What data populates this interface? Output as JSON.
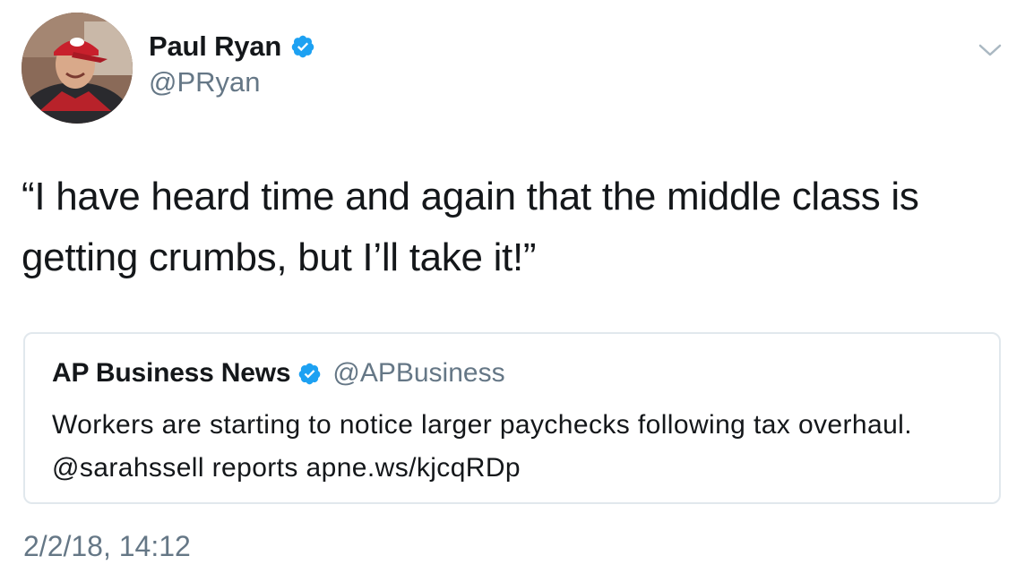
{
  "author": {
    "display_name": "Paul Ryan",
    "handle": "@PRyan",
    "verified": true,
    "avatar_icon": "profile-photo"
  },
  "tweet": {
    "text": "“I have heard time and again that the middle class is\ngetting crumbs, but I’ll take it!”",
    "timestamp": "2/2/18, 14:12"
  },
  "quoted_tweet": {
    "display_name": "AP Business News",
    "handle": "@APBusiness",
    "verified": true,
    "text": "Workers are starting to notice larger paychecks following tax overhaul. @sarahssell reports apne.ws/kjcqRDp"
  },
  "colors": {
    "text_primary": "#14171a",
    "text_secondary": "#657786",
    "verified_blue": "#1da1f2",
    "border": "#e1e8ed"
  },
  "icons": {
    "verified": "verified-badge-icon",
    "menu": "chevron-down-icon"
  }
}
